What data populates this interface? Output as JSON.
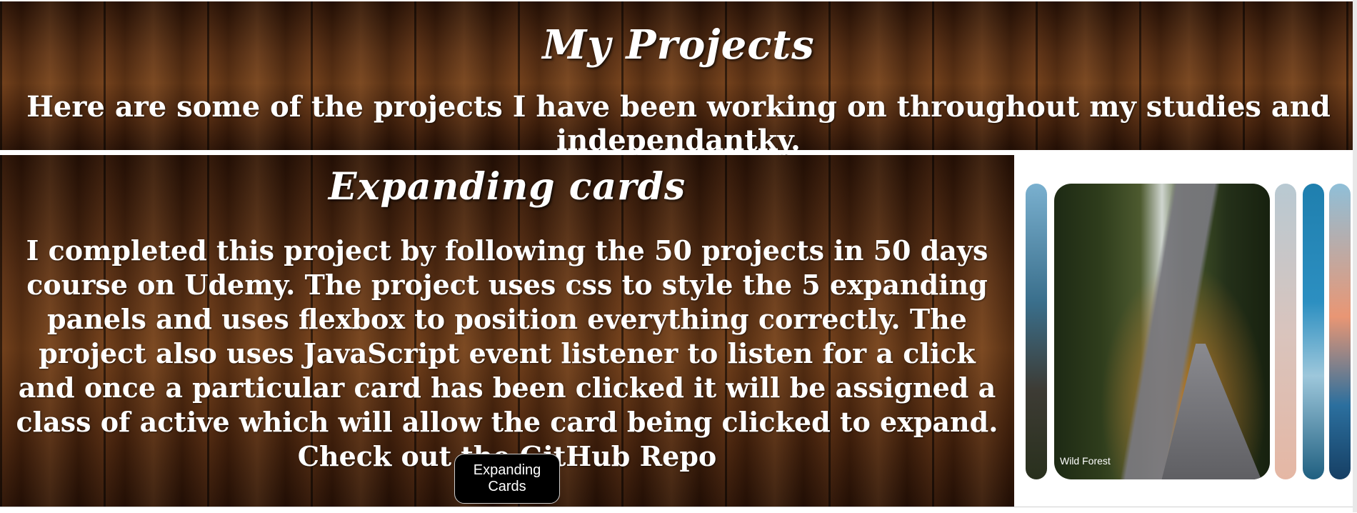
{
  "header": {
    "title": "My Projects",
    "subtitle": "Here are some of the projects I have been working on throughout my studies and independantky."
  },
  "project": {
    "title": "Expanding cards",
    "description": "I completed this project by following the 50 projects in 50 days course on Udemy. The project uses css to style the 5 expanding panels and uses flexbox to position everything correctly. The project also uses JavaScript event listener to listen for a click and once a particular card has been clicked it will be assigned a class of active which will allow the card being clicked to expand. Check out the GitHub Repo",
    "button_label": "Expanding Cards",
    "preview": {
      "active_panel_label": "Wild Forest"
    }
  }
}
